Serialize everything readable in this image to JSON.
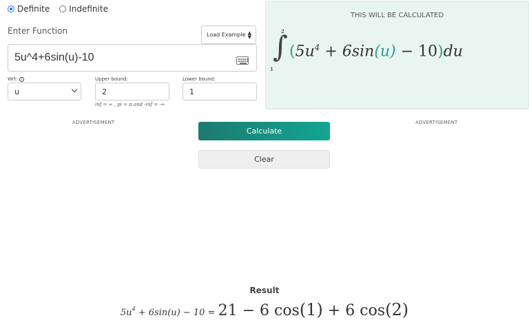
{
  "mode": {
    "options": [
      {
        "label": "Definite",
        "selected": true
      },
      {
        "label": "Indefinite",
        "selected": false
      }
    ]
  },
  "function_input": {
    "label": "Enter Function",
    "value": "5u^4+6sin(u)-10",
    "load_example": "Load Example"
  },
  "wrt": {
    "label": "Wrt:",
    "info_icon": "info-icon",
    "value": "u"
  },
  "upper_bound": {
    "label": "Upper bound:",
    "value": "2"
  },
  "lower_bound": {
    "label": "Lower bound:",
    "value": "1"
  },
  "hint": "inf = ∞ , pi = π and -inf = -∞",
  "preview": {
    "title": "THIS WILL BE CALCULATED",
    "upper": "2",
    "lower": "1",
    "integral_symbol": "∫",
    "open_paren": "(",
    "term1": "5u",
    "exp": "4",
    "op1": "+",
    "term2": "6sin",
    "arg": "(u)",
    "op2": "−",
    "term3": "10",
    "close_paren": ")",
    "du": "du"
  },
  "ads": {
    "left": "ADVERTISEMENT",
    "right": "ADVERTISEMENT"
  },
  "buttons": {
    "calculate": "Calculate",
    "clear": "Clear"
  },
  "result": {
    "title": "Result",
    "lhs_base": "5u",
    "lhs_exp": "4",
    "lhs_rest": " + 6sin(u) − 10 = ",
    "rhs_a": "21 − 6 cos",
    "rhs_a_arg": "(1)",
    "rhs_b": " + 6 cos",
    "rhs_b_arg": "(2)"
  },
  "colors": {
    "accent_teal": "#13a593",
    "preview_bg": "#e8f5f0",
    "radio_blue": "#1a73e8"
  }
}
